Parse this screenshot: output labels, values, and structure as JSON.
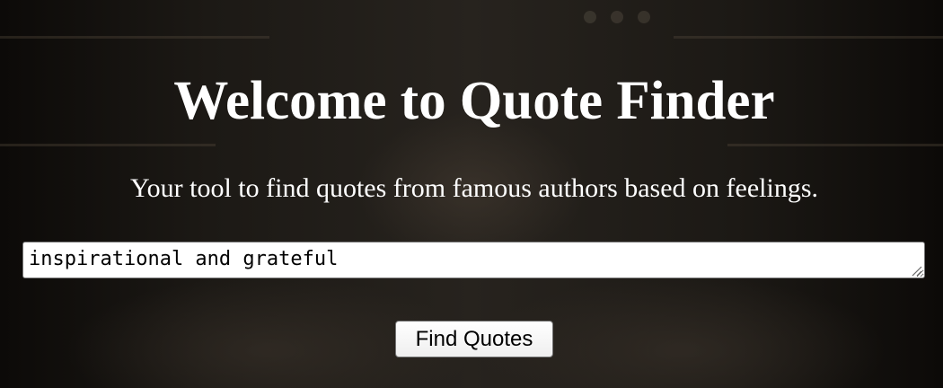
{
  "header": {
    "title": "Welcome to Quote Finder",
    "subtitle": "Your tool to find quotes from famous authors based on feelings."
  },
  "form": {
    "feelings_value": "inspirational and grateful",
    "submit_label": "Find Quotes"
  },
  "colors": {
    "text": "#ffffff",
    "background": "#141210",
    "input_background": "#ffffff",
    "button_background": "#efefef"
  }
}
